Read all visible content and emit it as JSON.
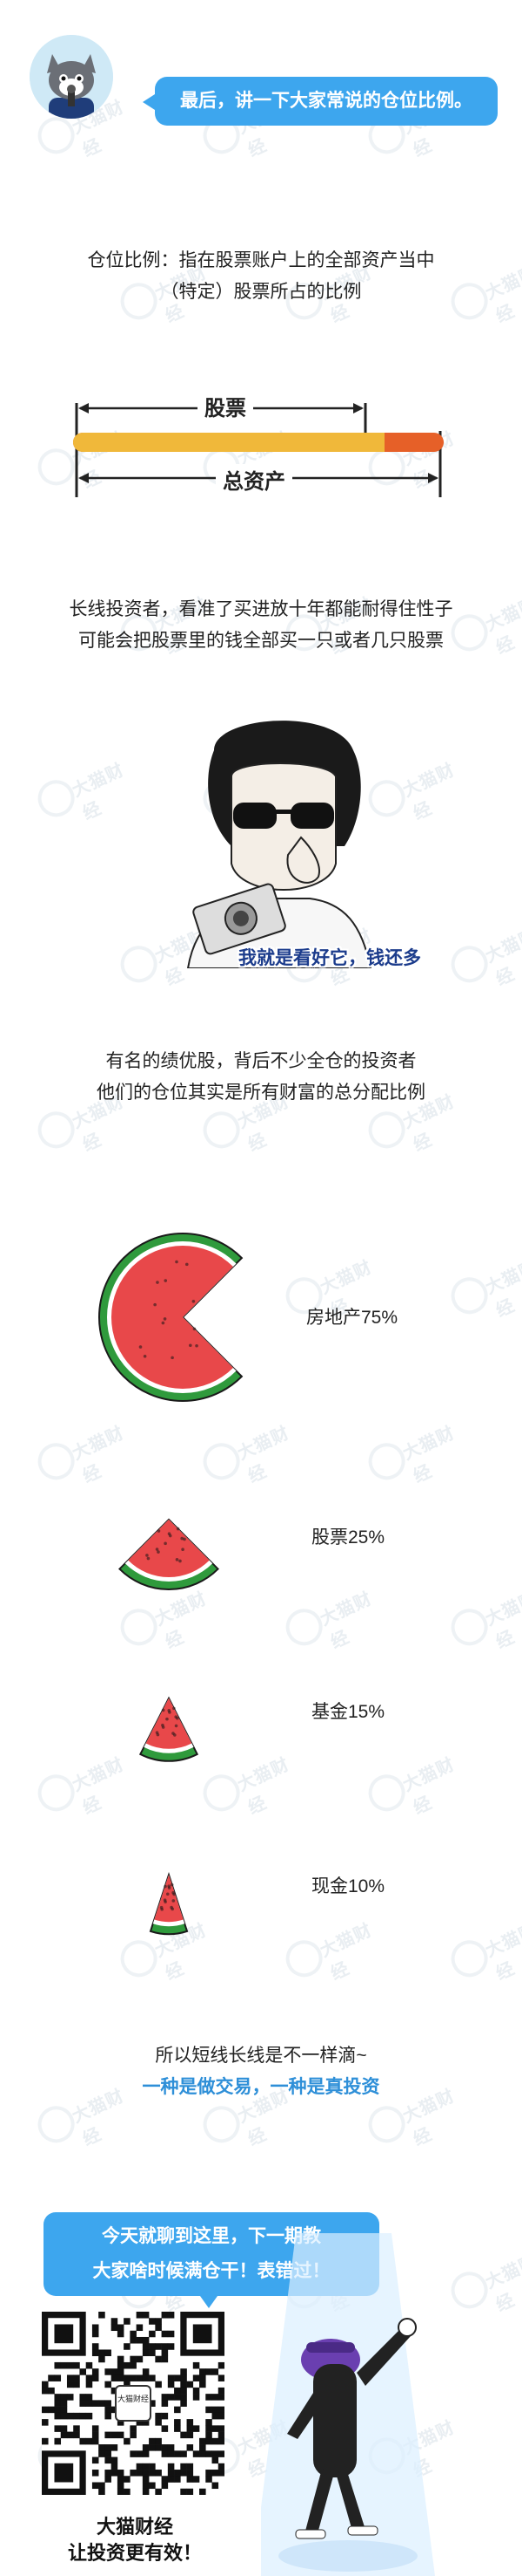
{
  "header": {
    "avatar_icon": "cat-avatar-icon",
    "bubble_text": "最后，讲一下大家常说的仓位比例。"
  },
  "definition": {
    "line1": "仓位比例：指在股票账户上的全部资产当中",
    "line2": "（特定）股票所占的比例"
  },
  "bar": {
    "stock_label": "股票",
    "total_label": "总资产",
    "stock_fraction": 0.84,
    "colors": {
      "stock": "#f0b83a",
      "rest": "#e66028",
      "outline": "#222222"
    }
  },
  "long_term": {
    "line1": "长线投资者，看准了买进放十年都能耐得住性子",
    "line2": "可能会把股票里的钱全部买一只或者几只股票",
    "illustration_icon": "man-with-sunglasses-camera-illustration",
    "caption": "我就是看好它，钱还多"
  },
  "blue_chip": {
    "line1": "有名的绩优股，背后不少全仓的投资者",
    "line2": "他们的仓位其实是所有财富的总分配比例"
  },
  "allocation": [
    {
      "label": "房地产75%",
      "value": 75
    },
    {
      "label": "股票25%",
      "value": 25
    },
    {
      "label": "基金15%",
      "value": 15
    },
    {
      "label": "现金10%",
      "value": 10
    }
  ],
  "allocation_colors": {
    "flesh": "#e8484a",
    "rind": "#2f9a3c",
    "white": "#ffffff",
    "seed": "#2a1a1a",
    "outline": "#1a1a1a"
  },
  "summary": {
    "line1": "所以短线长线是不一样滴~",
    "line2": "一种是做交易，一种是真投资"
  },
  "footer": {
    "bubble_line1": "今天就聊到这里，下一期教",
    "bubble_line2": "大家啥时候满仓干！表错过！",
    "qr_icon": "qr-code-icon",
    "qr_logo_text": "大猫财经",
    "brand_name": "大猫财经",
    "brand_slogan": "让投资更有效！",
    "mascot_icon": "dancing-cat-mascot-icon"
  },
  "watermark": {
    "text": "大猫财经"
  }
}
